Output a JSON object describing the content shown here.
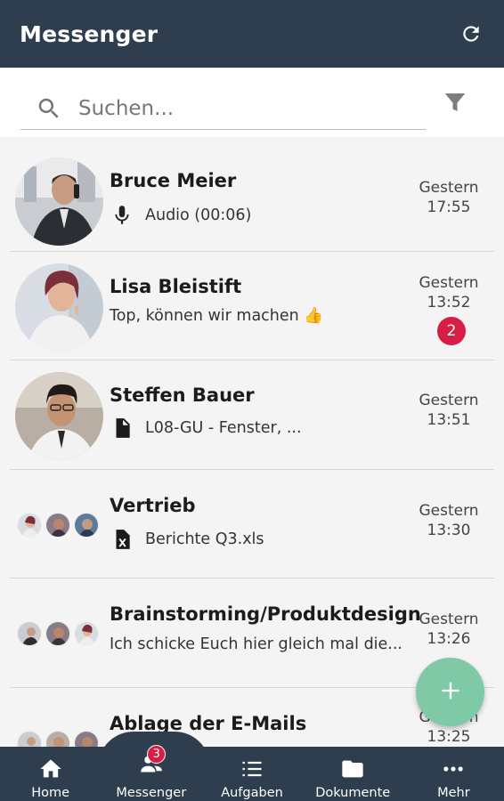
{
  "header": {
    "title": "Messenger",
    "refresh_icon": "refresh-icon"
  },
  "search": {
    "placeholder": "Suchen...",
    "icon": "search-icon",
    "filter_icon": "filter-icon"
  },
  "conversations": [
    {
      "name": "Bruce Meier",
      "preview": "Audio (00:06)",
      "preview_icon": "microphone-icon",
      "day": "Gestern",
      "time": "17:55",
      "unread": null
    },
    {
      "name": "Lisa Bleistift",
      "preview": "Top, können wir machen 👍",
      "preview_icon": null,
      "day": "Gestern",
      "time": "13:52",
      "unread": "2"
    },
    {
      "name": "Steffen Bauer",
      "preview": "L08-GU - Fenster, ...",
      "preview_icon": "document-icon",
      "day": "Gestern",
      "time": "13:51",
      "unread": null
    },
    {
      "name": "Vertrieb",
      "preview": "Berichte Q3.xls",
      "preview_icon": "excel-file-icon",
      "day": "Gestern",
      "time": "13:30",
      "unread": null
    },
    {
      "name": "Brainstorming/Produktdesign",
      "preview": "Ich schicke Euch hier gleich mal die...",
      "preview_icon": null,
      "day": "Gestern",
      "time": "13:26",
      "unread": null
    },
    {
      "name": "Ablage der E-Mails",
      "preview": "",
      "preview_icon": null,
      "day": "Gestern",
      "time": "13:25",
      "unread": null
    }
  ],
  "fab": {
    "icon": "plus-icon",
    "color": "#7fc9a6"
  },
  "nav": {
    "items": [
      {
        "label": "Home",
        "icon": "home-icon"
      },
      {
        "label": "Messenger",
        "icon": "people-icon",
        "badge": "3"
      },
      {
        "label": "Aufgaben",
        "icon": "task-list-icon"
      },
      {
        "label": "Dokumente",
        "icon": "folder-icon"
      },
      {
        "label": "Mehr",
        "icon": "more-icon"
      }
    ]
  },
  "colors": {
    "bar": "#2f3e4f",
    "badge": "#d81e45",
    "background": "#f4f4f4"
  }
}
